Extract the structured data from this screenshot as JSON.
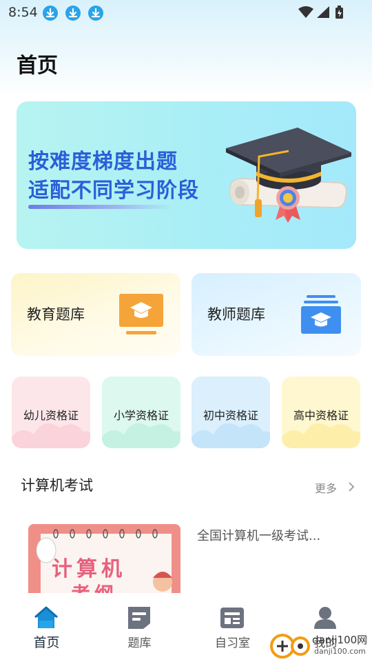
{
  "status_bar": {
    "time": "8:54"
  },
  "header": {
    "title": "首页"
  },
  "banner": {
    "line1": "按难度梯度出题",
    "line2": "适配不同学习阶段"
  },
  "big_cards": [
    {
      "label": "教育题库",
      "icon": "graduation-cap-monitor-icon",
      "accent": "#f5a43a"
    },
    {
      "label": "教师题库",
      "icon": "graduation-cap-stack-icon",
      "accent": "#3f8ff0"
    }
  ],
  "small_cards": [
    {
      "label": "幼儿资格证",
      "color": "#fde6ea"
    },
    {
      "label": "小学资格证",
      "color": "#dcf8ef"
    },
    {
      "label": "初中资格证",
      "color": "#dbeffd"
    },
    {
      "label": "高中资格证",
      "color": "#fff7cf"
    }
  ],
  "section": {
    "title": "计算机考试",
    "more": "更多"
  },
  "course": {
    "image_text_1": "计算机",
    "image_text_2": "考纲",
    "title": "全国计算机一级考试..."
  },
  "bottom_nav": [
    {
      "label": "首页",
      "icon": "home-icon",
      "active": true
    },
    {
      "label": "题库",
      "icon": "question-bank-icon",
      "active": false
    },
    {
      "label": "自习室",
      "icon": "study-room-icon",
      "active": false
    },
    {
      "label": "我的",
      "icon": "profile-icon",
      "active": false
    }
  ],
  "watermark": {
    "text": "danji100网",
    "sub": "danji100.com"
  },
  "colors": {
    "accent": "#2a5fd8",
    "nav_active": "#1a8fd6"
  }
}
